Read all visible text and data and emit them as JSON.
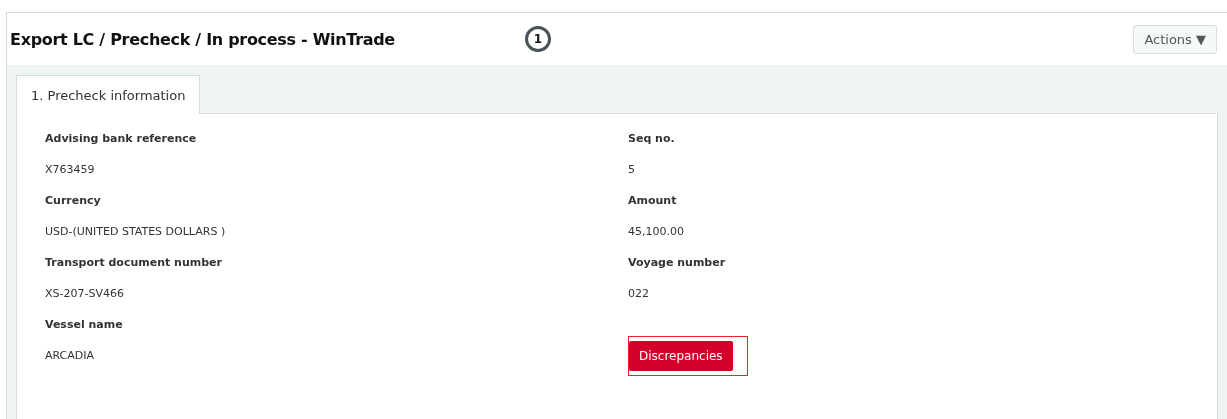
{
  "header": {
    "title": "Export LC / Precheck / In process - WinTrade",
    "callout": "1",
    "actions_button": "Actions ▼"
  },
  "tabs": [
    {
      "label": "1. Precheck information",
      "selected": true
    }
  ],
  "columns": [
    {
      "fields": [
        {
          "label": "Advising bank reference",
          "value": "X763459"
        },
        {
          "label": "Currency",
          "value": "USD-(UNITED STATES DOLLARS )"
        },
        {
          "label": "Transport document number",
          "value": "XS-207-SV466"
        },
        {
          "label": "Vessel name",
          "value": "ARCADIA"
        }
      ]
    },
    {
      "fields": [
        {
          "label": "Seq no.",
          "value": "5"
        },
        {
          "label": "Amount",
          "value": "45,100.00"
        },
        {
          "label": "Voyage number",
          "value": "022"
        }
      ],
      "button": {
        "label": "Discrepancies",
        "highlighted": true
      }
    }
  ]
}
